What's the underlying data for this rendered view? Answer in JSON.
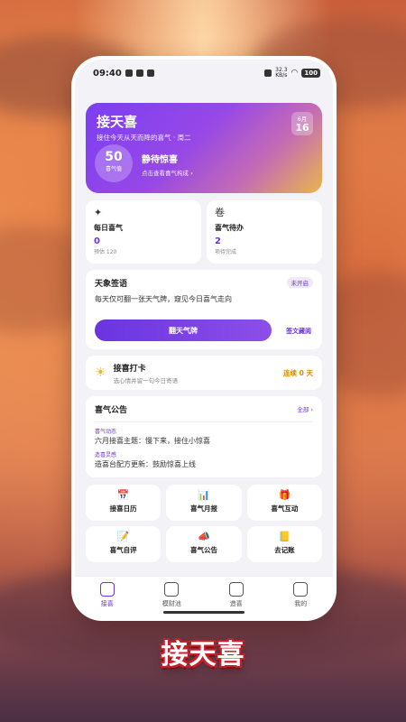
{
  "status_bar": {
    "time": "09:40",
    "speed_value": "32.3",
    "speed_unit": "KB/s",
    "battery": "100"
  },
  "hero": {
    "title": "接天喜",
    "subtitle": "接住今天从天而降的喜气 · 周二",
    "month": "6月",
    "day": "16",
    "score": "50",
    "score_label": "喜气值",
    "status_title": "静待惊喜",
    "status_hint": "点击查看喜气构成 ›"
  },
  "daily_card": {
    "icon": "✦",
    "title": "每日喜气",
    "value": "0",
    "sub": "预估 120"
  },
  "todo_card": {
    "icon": "卷",
    "title": "喜气待办",
    "value": "2",
    "sub": "项待完成"
  },
  "sign": {
    "title": "天象签语",
    "tag": "未开启",
    "desc": "每天仅可翻一张天气牌，窥见今日喜气走向",
    "button": "翻天气牌",
    "collection_link": "签文藏阅"
  },
  "checkin": {
    "icon": "☀",
    "title": "接喜打卡",
    "sub": "选心情并留一句今日寄语",
    "streak": "连续 0 天"
  },
  "notice": {
    "title": "喜气公告",
    "all_link": "全部 ›",
    "items": [
      {
        "tag": "喜气动态",
        "text": "六月接喜主题：慢下来，接住小惊喜"
      },
      {
        "tag": "造喜灵感",
        "text": "造喜台配方更新：鼓励惊喜上线"
      }
    ]
  },
  "grid": [
    {
      "icon": "📅",
      "label": "接喜日历"
    },
    {
      "icon": "📊",
      "label": "喜气月报"
    },
    {
      "icon": "🎁",
      "label": "喜气互动"
    },
    {
      "icon": "📝",
      "label": "喜气自评"
    },
    {
      "icon": "📣",
      "label": "喜气公告"
    },
    {
      "icon": "📒",
      "label": "去记账"
    }
  ],
  "tabs": [
    {
      "icon": "home-icon",
      "label": "接喜"
    },
    {
      "icon": "grid-icon",
      "label": "模财池"
    },
    {
      "icon": "calculator-icon",
      "label": "造喜"
    },
    {
      "icon": "profile-icon",
      "label": "我的"
    }
  ],
  "brand_text": "接天喜",
  "colors": {
    "accent": "#6a34e0",
    "streak": "#d68a00",
    "brand_outline": "#c8202a"
  }
}
